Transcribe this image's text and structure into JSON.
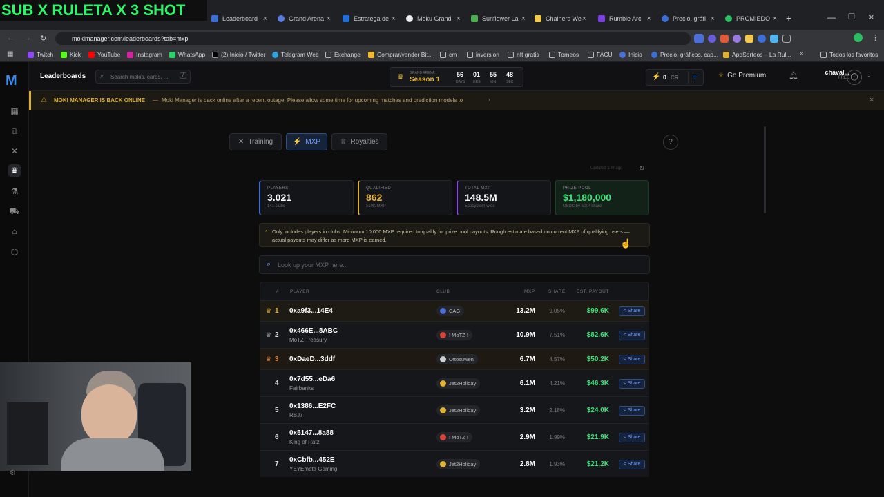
{
  "browser": {
    "tabs": [
      {
        "label": "SUB X RULETA X 3 SHOT",
        "active": false
      },
      {
        "label": "Leaderboard",
        "active": true
      },
      {
        "label": "Grand Arena",
        "active": false
      },
      {
        "label": "Estratega de",
        "active": false
      },
      {
        "label": "Moku Grand",
        "active": false
      },
      {
        "label": "Sunflower La",
        "active": false
      },
      {
        "label": "Chainers We",
        "active": false
      },
      {
        "label": "Rumble Arc",
        "active": false
      },
      {
        "label": "Precio, gráfi",
        "active": false
      },
      {
        "label": "PROMIEDO",
        "active": false
      }
    ],
    "url": "mokimanager.com/leaderboards?tab=mxp",
    "bookmarks": [
      "Twitch",
      "Kick",
      "YouTube",
      "Instagram",
      "WhatsApp",
      "(2) Inicio / Twitter",
      "Telegram Web",
      "Exchange",
      "Comprar/vender Bit...",
      "cm",
      "inversion",
      "nft gratis",
      "Torneos",
      "FACU",
      "Inicio",
      "Precio, gráficos, cap...",
      "AppSorteos – La Rul...",
      "Todos los favoritos"
    ]
  },
  "overlay": {
    "stream_title": "SUB X RULETA X 3 SHOT"
  },
  "app": {
    "section_title": "Leaderboards",
    "search_placeholder": "Search mokis, cards, ...",
    "search_shortcut": "/",
    "season": {
      "label": "GRAND ARENA",
      "name": "Season 1",
      "days": "56",
      "hrs": "01",
      "min": "55",
      "sec": "48",
      "days_lbl": "DAYS",
      "hrs_lbl": "HRS",
      "min_lbl": "MIN",
      "sec_lbl": "SEC"
    },
    "credits": {
      "value": "0",
      "unit": "CR"
    },
    "premium_label": "Go Premium",
    "user": {
      "name": "chaval...",
      "tier": "FREE"
    },
    "banner": {
      "title": "MOKI MANAGER IS BACK ONLINE",
      "text": "Moki Manager is back online after a recent outage. Please allow some time for upcoming matches and prediction models to"
    },
    "tabs": [
      "Training",
      "MXP",
      "Royalties"
    ],
    "updated": "Updated 1 hr ago",
    "stats": [
      {
        "label": "PLAYERS",
        "value": "3.021",
        "sub": "141 clubs",
        "accent": "#3b6fd8"
      },
      {
        "label": "QUALIFIED",
        "value": "862",
        "sub": "≥10K MXP",
        "accent": "#e0b133"
      },
      {
        "label": "TOTAL MXP",
        "value": "148.5M",
        "sub": "Ecosystem-wide",
        "accent": "#8b44e6"
      },
      {
        "label": "PRIZE POOL",
        "value": "$1,180,000",
        "sub": "USDC by MXP share",
        "accent": "#2bbf62"
      }
    ],
    "note": "Only includes players in clubs. Minimum 10,000 MXP required to qualify for prize pool payouts. Rough estimate based on current MXP of qualifying users — actual payouts may differ as more MXP is earned.",
    "lookup_placeholder": "Look up your MXP here...",
    "columns": [
      "#",
      "PLAYER",
      "CLUB",
      "MXP",
      "SHARE",
      "EST. PAYOUT"
    ],
    "share_label": "Share",
    "rows": [
      {
        "rank": "1",
        "player": "0xa9f3...14E4",
        "sub": "",
        "club": "CAG",
        "club_color": "#4a6fd8",
        "mxp": "13.2M",
        "share": "9.05%",
        "payout": "$99.6K"
      },
      {
        "rank": "2",
        "player": "0x466E...8ABC",
        "sub": "MoTZ Treasury",
        "club": "! MoTZ !",
        "club_color": "#d8443a",
        "mxp": "10.9M",
        "share": "7.51%",
        "payout": "$82.6K"
      },
      {
        "rank": "3",
        "player": "0xDaeD...3ddf",
        "sub": "",
        "club": "Ottosuwen",
        "club_color": "#cfcfcf",
        "mxp": "6.7M",
        "share": "4.57%",
        "payout": "$50.2K"
      },
      {
        "rank": "4",
        "player": "0x7d55...eDa6",
        "sub": "Fairbanks",
        "club": "Jet2Holiday",
        "club_color": "#e0b133",
        "mxp": "6.1M",
        "share": "4.21%",
        "payout": "$46.3K"
      },
      {
        "rank": "5",
        "player": "0x1386...E2FC",
        "sub": "RBJ7",
        "club": "Jet2Holiday",
        "club_color": "#e0b133",
        "mxp": "3.2M",
        "share": "2.18%",
        "payout": "$24.0K"
      },
      {
        "rank": "6",
        "player": "0x5147...8a88",
        "sub": "King of Ratz",
        "club": "! MoTZ !",
        "club_color": "#d8443a",
        "mxp": "2.9M",
        "share": "1.99%",
        "payout": "$21.9K"
      },
      {
        "rank": "7",
        "player": "0xCbfb...452E",
        "sub": "YEYEmeta Gaming",
        "club": "Jet2Holiday",
        "club_color": "#e0b133",
        "mxp": "2.8M",
        "share": "1.93%",
        "payout": "$21.2K"
      }
    ]
  }
}
